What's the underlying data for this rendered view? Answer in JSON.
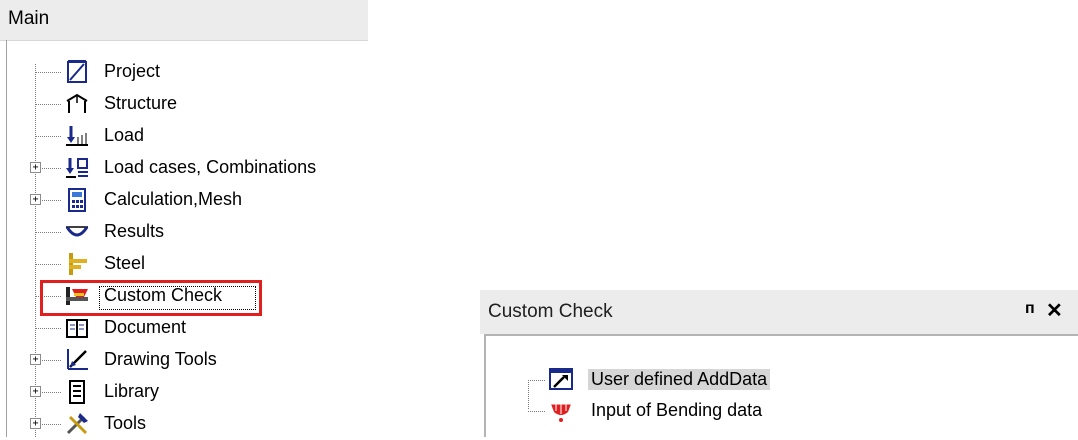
{
  "main_panel": {
    "title": "Main",
    "items": [
      {
        "label": "Project",
        "icon": "project-icon",
        "expandable": false
      },
      {
        "label": "Structure",
        "icon": "structure-icon",
        "expandable": false
      },
      {
        "label": "Load",
        "icon": "load-icon",
        "expandable": false
      },
      {
        "label": "Load cases, Combinations",
        "icon": "load-cases-icon",
        "expandable": true,
        "expander": "+"
      },
      {
        "label": "Calculation,Mesh",
        "icon": "calculator-icon",
        "expandable": true,
        "expander": "+"
      },
      {
        "label": "Results",
        "icon": "results-icon",
        "expandable": false
      },
      {
        "label": "Steel",
        "icon": "steel-icon",
        "expandable": false
      },
      {
        "label": "Custom Check",
        "icon": "custom-check-icon",
        "expandable": false,
        "highlighted": true
      },
      {
        "label": "Document",
        "icon": "document-icon",
        "expandable": false
      },
      {
        "label": "Drawing Tools",
        "icon": "drawing-tools-icon",
        "expandable": true,
        "expander": "+"
      },
      {
        "label": "Library",
        "icon": "library-icon",
        "expandable": true,
        "expander": "+"
      },
      {
        "label": "Tools",
        "icon": "tools-icon",
        "expandable": true,
        "expander": "+"
      }
    ],
    "highlight_color": "#e0201e"
  },
  "custom_check_panel": {
    "title": "Custom Check",
    "pin_glyph": "ᴨ",
    "close_glyph": "✕",
    "items": [
      {
        "label": "User defined AddData",
        "icon": "user-defined-adddata-icon",
        "selected": true
      },
      {
        "label": "Input of Bending data",
        "icon": "bending-data-icon",
        "selected": false
      }
    ]
  }
}
